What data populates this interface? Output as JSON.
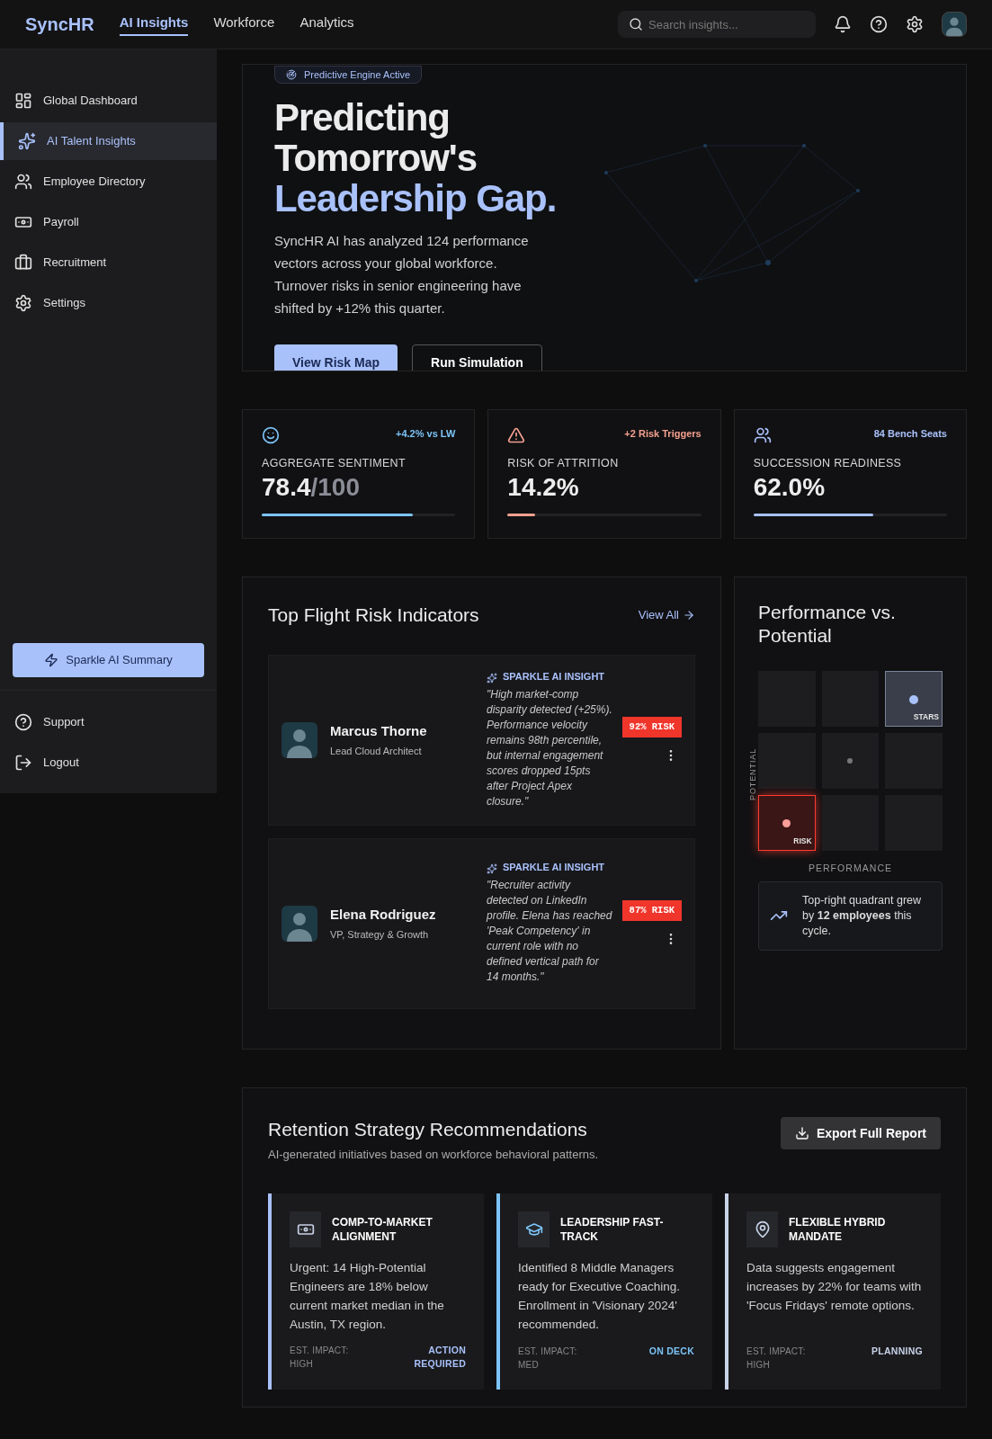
{
  "topbar": {
    "brand": "SyncHR",
    "nav": [
      {
        "label": "AI Insights",
        "selected": true
      },
      {
        "label": "Workforce",
        "selected": false
      },
      {
        "label": "Analytics",
        "selected": false
      }
    ],
    "search": {
      "placeholder": "Search insights..."
    }
  },
  "sidebar": {
    "items": [
      {
        "label": "Global Dashboard",
        "kind": "dashboard",
        "selected": false
      },
      {
        "label": "AI Talent Insights",
        "kind": "sparkle",
        "selected": true
      },
      {
        "label": "Employee Directory",
        "kind": "people",
        "selected": false
      },
      {
        "label": "Payroll",
        "kind": "money",
        "selected": false
      },
      {
        "label": "Recruitment",
        "kind": "briefcase",
        "selected": false
      },
      {
        "label": "Settings",
        "kind": "gear",
        "selected": false
      }
    ],
    "action": "Sparkle AI Summary",
    "footer": [
      {
        "label": "Support",
        "kind": "help"
      },
      {
        "label": "Logout",
        "kind": "logout"
      }
    ]
  },
  "hero": {
    "badge": "Predictive Engine Active",
    "title_lines": [
      "Predicting",
      "Tomorrow's"
    ],
    "title_highlight": "Leadership Gap.",
    "body": "SyncHR AI has analyzed 124 performance vectors across your global workforce. Turnover risks in senior engineering have shifted by +12% this quarter.",
    "buttons": [
      {
        "label": "View Risk Map",
        "kind": "primary"
      },
      {
        "label": "Run Simulation",
        "kind": "secondary"
      }
    ]
  },
  "kpis": [
    {
      "kind": "sentiment",
      "delta": "+4.2% vs LW",
      "label": "AGGREGATE SENTIMENT",
      "value": "78.4",
      "suffix": "/100",
      "level": 0.78,
      "color": "#7cc4f8"
    },
    {
      "kind": "risk",
      "delta": "+2 Risk Triggers",
      "label": "RISK OF ATTRITION",
      "value": "14.2%",
      "level": 0.142,
      "color": "#f4a08f"
    },
    {
      "kind": "succession",
      "delta": "84 Bench Seats",
      "label": "SUCCESSION READINESS",
      "value": "62.0%",
      "level": 0.62,
      "color": "#a9c1fb"
    }
  ],
  "flight_risk": {
    "title": "Top Flight Risk Indicators",
    "link": "View All",
    "people": [
      {
        "name": "Marcus Thorne",
        "role": "Lead Cloud Architect",
        "insight_label": "SPARKLE AI INSIGHT",
        "insight": "\"High market-comp disparity detected (+25%). Performance velocity remains 98th percentile, but internal engagement scores dropped 15pts after Project Apex closure.\"",
        "risk": "92% RISK"
      },
      {
        "name": "Elena Rodriguez",
        "role": "VP, Strategy & Growth",
        "insight_label": "SPARKLE AI INSIGHT",
        "insight": "\"Recruiter activity detected on LinkedIn profile. Elena has reached 'Peak Competency' in current role with no defined vertical path for 14 months.\"",
        "risk": "87% RISK"
      }
    ]
  },
  "matrix": {
    "title": "Performance vs. Potential",
    "y_axis": "POTENTIAL",
    "x_axis": "PERFORMANCE",
    "cells": [
      {
        "kind": "empty"
      },
      {
        "kind": "empty"
      },
      {
        "kind": "stars",
        "label": "STARS"
      },
      {
        "kind": "empty"
      },
      {
        "kind": "dot"
      },
      {
        "kind": "empty"
      },
      {
        "kind": "risk",
        "label": "RISK"
      },
      {
        "kind": "empty"
      },
      {
        "kind": "empty"
      }
    ],
    "note": "Top-right quadrant grew by **12 employees** this cycle."
  },
  "retention": {
    "title": "Retention Strategy Recommendations",
    "subtitle": "AI-generated initiatives based on workforce behavioral patterns.",
    "export": "Export Full Report",
    "cards": [
      {
        "kind": "money",
        "title": "COMP-TO-MARKET ALIGNMENT",
        "body": "Urgent: 14 High-Potential Engineers are 18% below current market median in the Austin, TX region.",
        "impact": "EST. IMPACT: HIGH",
        "status": "ACTION REQUIRED",
        "color": "#a9c1fb"
      },
      {
        "kind": "grad",
        "title": "LEADERSHIP FAST-TRACK",
        "body": "Identified 8 Middle Managers ready for Executive Coaching. Enrollment in 'Visionary 2024' recommended.",
        "impact": "EST. IMPACT: MED",
        "status": "ON DECK",
        "color": "#7cc4f8"
      },
      {
        "kind": "pin",
        "title": "FLEXIBLE HYBRID MANDATE",
        "body": "Data suggests engagement increases by 22% for teams with 'Focus Fridays' remote options.",
        "impact": "EST. IMPACT: HIGH",
        "status": "PLANNING",
        "color": "#c8d2e8"
      }
    ]
  }
}
